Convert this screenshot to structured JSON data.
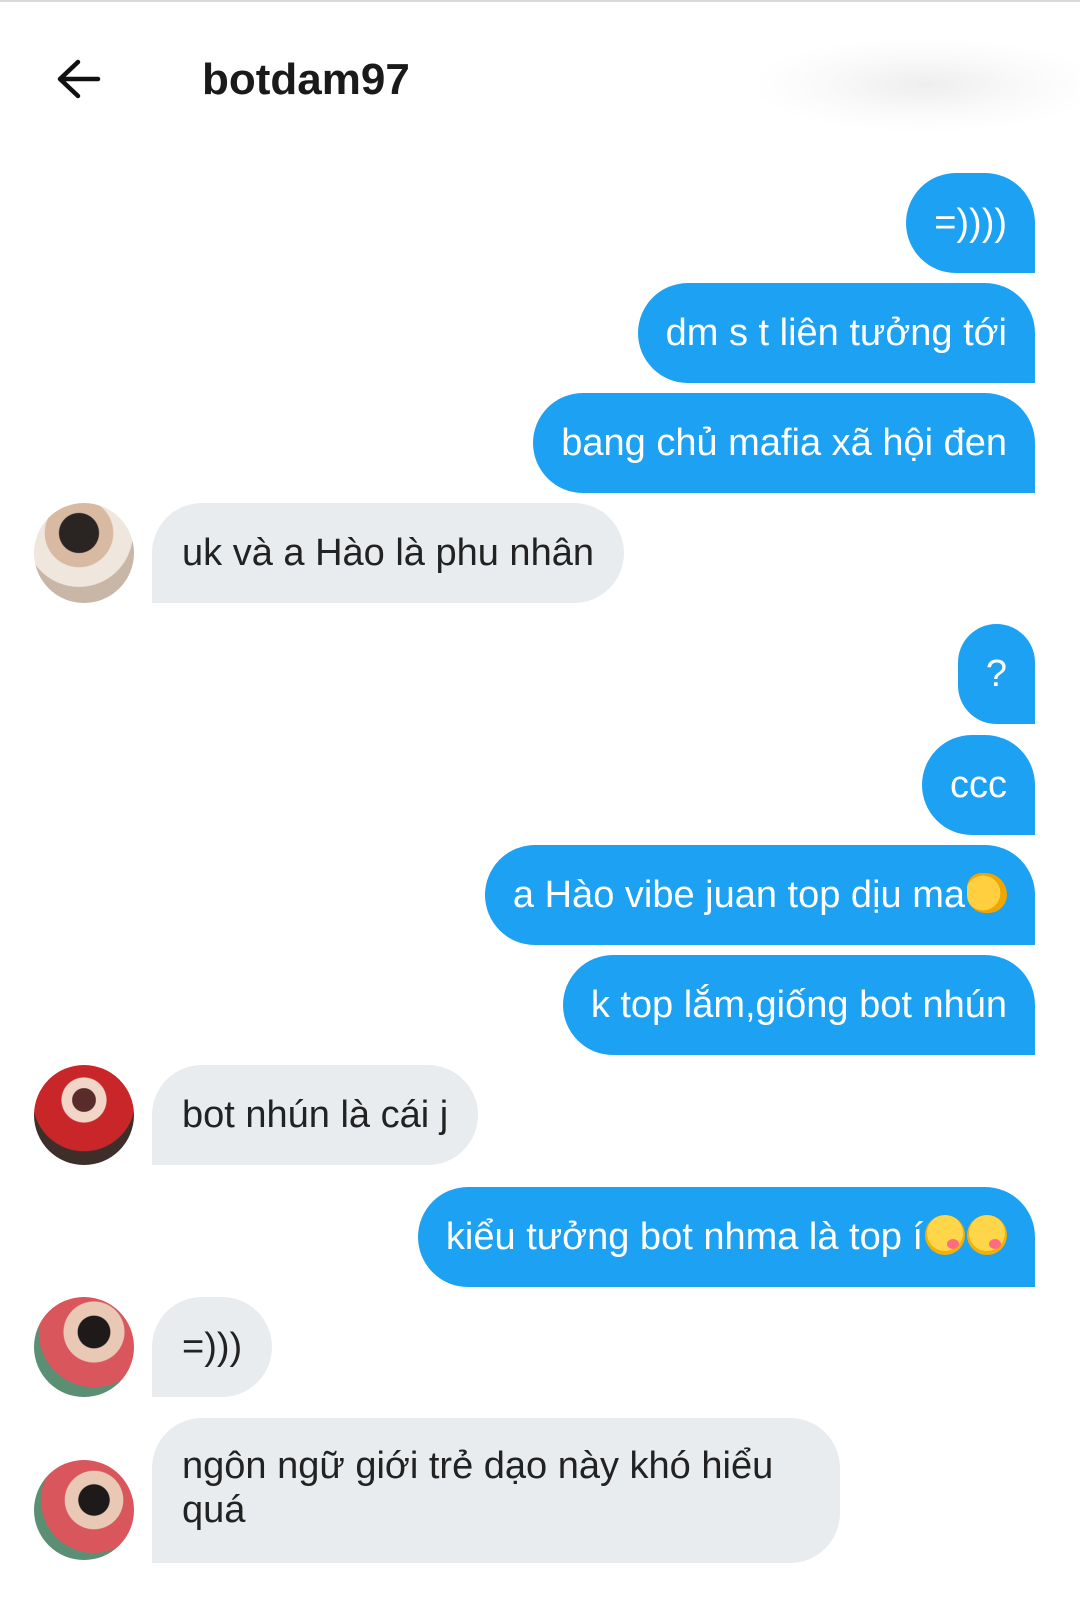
{
  "header": {
    "title": "botdam97"
  },
  "icons": {
    "back": "arrow-left-icon",
    "emoji_pinch": "pinching-hand-emoji",
    "emoji_yum": "face-savoring-food-emoji"
  },
  "colors": {
    "outgoing_bubble": "#1da1f2",
    "incoming_bubble": "#e8ecef"
  },
  "messages": [
    {
      "side": "out",
      "text": "=))))"
    },
    {
      "side": "out",
      "text": "dm s t liên tưởng tới"
    },
    {
      "side": "out",
      "text": "bang chủ mafia xã hội đen"
    },
    {
      "side": "in",
      "text": "uk và a Hào là phu nhân"
    },
    {
      "side": "out",
      "text": "?"
    },
    {
      "side": "out",
      "text": "ccc"
    },
    {
      "side": "out",
      "text": "a Hào vibe juan top dịu ma"
    },
    {
      "side": "out",
      "text": "k top lắm,giống bot nhún"
    },
    {
      "side": "in",
      "text": "bot nhún là cái j"
    },
    {
      "side": "out",
      "text": "kiểu tưởng bot nhma là top í"
    },
    {
      "side": "in",
      "text": "=)))"
    },
    {
      "side": "in",
      "text": "ngôn ngữ giới trẻ dạo này khó hiểu quá"
    }
  ]
}
